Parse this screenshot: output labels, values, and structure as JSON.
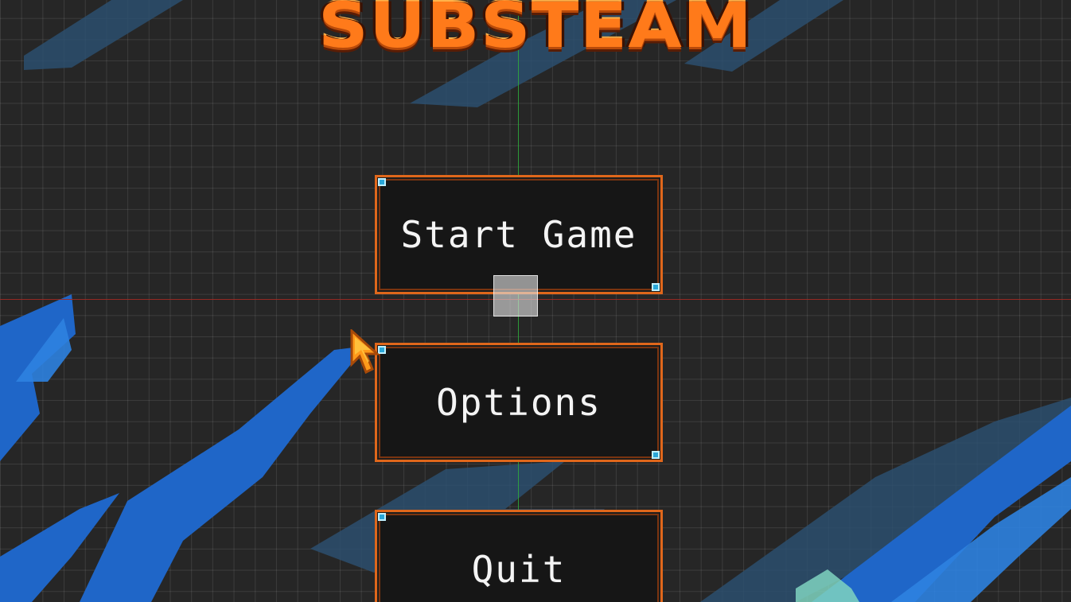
{
  "game": {
    "title": "SUBSTEAM"
  },
  "menu": {
    "start": "Start Game",
    "options": "Options",
    "quit": "Quit"
  },
  "colors": {
    "background": "#262626",
    "grid": "#3a3a3a",
    "title_orange": "#ff7a1a",
    "button_border": "#e0671b",
    "button_fill": "#161616",
    "handle": "#2aa7d8",
    "guide_vertical": "#2fae3c",
    "guide_horizontal": "#a22a22",
    "streak_blue": "#2a6fd0",
    "streak_dark": "#2a4a66"
  },
  "icons": {
    "cursor": "arrow-cursor-icon",
    "pivot": "pivot-gizmo-icon",
    "handle": "resize-handle-icon"
  }
}
